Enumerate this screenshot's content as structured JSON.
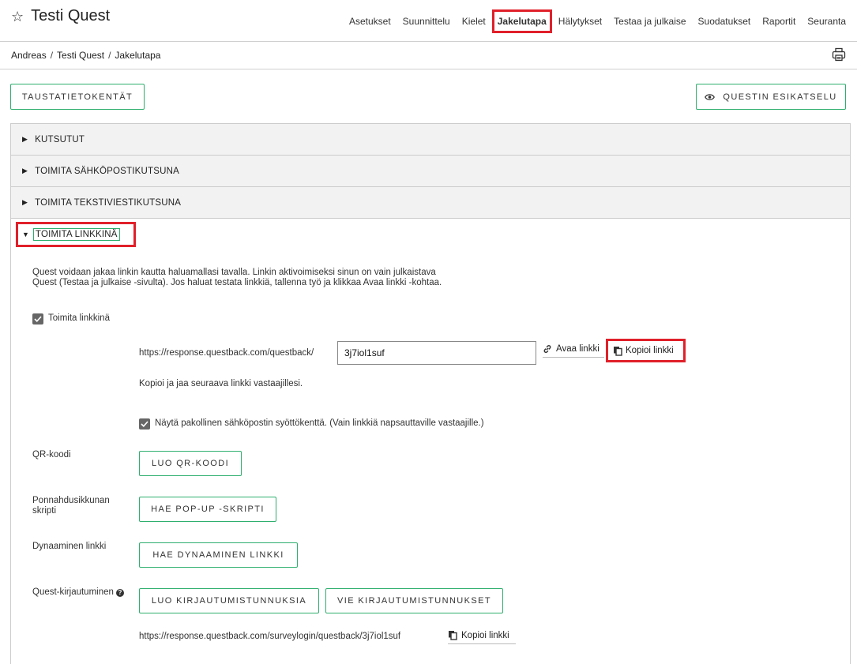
{
  "header": {
    "app_title": "Testi Quest",
    "star_icon": "star-outline-icon",
    "nav": [
      {
        "label": "Asetukset"
      },
      {
        "label": "Suunnittelu"
      },
      {
        "label": "Kielet"
      },
      {
        "label": "Jakelutapa",
        "active": true
      },
      {
        "label": "Hälytykset"
      },
      {
        "label": "Testaa ja julkaise"
      },
      {
        "label": "Suodatukset"
      },
      {
        "label": "Raportit"
      },
      {
        "label": "Seuranta"
      }
    ]
  },
  "breadcrumb": {
    "items": [
      "Andreas",
      "Testi Quest",
      "Jakelutapa"
    ],
    "separator": "/",
    "print_icon": "print-icon"
  },
  "toolbar": {
    "background_fields_label": "TAUSTATIETOKENTÄT",
    "preview_label": "QUESTIN ESIKATSELU",
    "preview_icon": "eye-icon"
  },
  "accordion": {
    "sections": [
      {
        "label": "KUTSUTUT",
        "expanded": false
      },
      {
        "label": "TOIMITA SÄHKÖPOSTIKUTSUNA",
        "expanded": false
      },
      {
        "label": "TOIMITA TEKSTIVIESTIKUTSUNA",
        "expanded": false
      },
      {
        "label": "TOIMITA LINKKINÄ",
        "expanded": true
      }
    ]
  },
  "link_section": {
    "description_line1": "Quest voidaan jakaa linkin kautta haluamallasi tavalla. Linkin aktivoimiseksi sinun on vain julkaistava",
    "description_line2": "Quest (Testaa ja julkaise -sivulta). Jos haluat testata linkkiä, tallenna työ ja klikkaa Avaa linkki -kohtaa.",
    "deliver_as_link_label": "Toimita linkkinä",
    "deliver_as_link_checked": true,
    "url_prefix": "https://response.questback.com/questback/",
    "url_value": "3j7iol1suf",
    "open_link_label": "Avaa linkki",
    "open_link_icon": "link-icon",
    "copy_link_label": "Kopioi linkki",
    "copy_link_icon": "copy-icon",
    "copy_hint": "Kopioi ja jaa seuraava linkki vastaajillesi.",
    "email_field_label": "Näytä pakollinen sähköpostin syöttökenttä. (Vain linkkiä napsauttaville vastaajille.)",
    "email_field_checked": true,
    "qr_label": "QR-koodi",
    "qr_button": "LUO QR-KOODI",
    "popup_label_line1": "Ponnahdusikkunan",
    "popup_label_line2": "skripti",
    "popup_button": "HAE POP-UP -SKRIPTI",
    "dynamic_label": "Dynaaminen linkki",
    "dynamic_button": "HAE DYNAAMINEN LINKKI",
    "login_label": "Quest-kirjautuminen",
    "login_help_icon": "help-icon",
    "login_create_button": "LUO KIRJAUTUMISTUNNUKSIA",
    "login_export_button": "VIE KIRJAUTUMISTUNNUKSET",
    "login_url": "https://response.questback.com/surveylogin/questback/3j7iol1suf",
    "login_copy_label": "Kopioi linkki"
  },
  "colors": {
    "accent_green": "#2eaf6e",
    "highlight_red": "#e0202a",
    "accordion_bg": "#f2f2f2"
  }
}
